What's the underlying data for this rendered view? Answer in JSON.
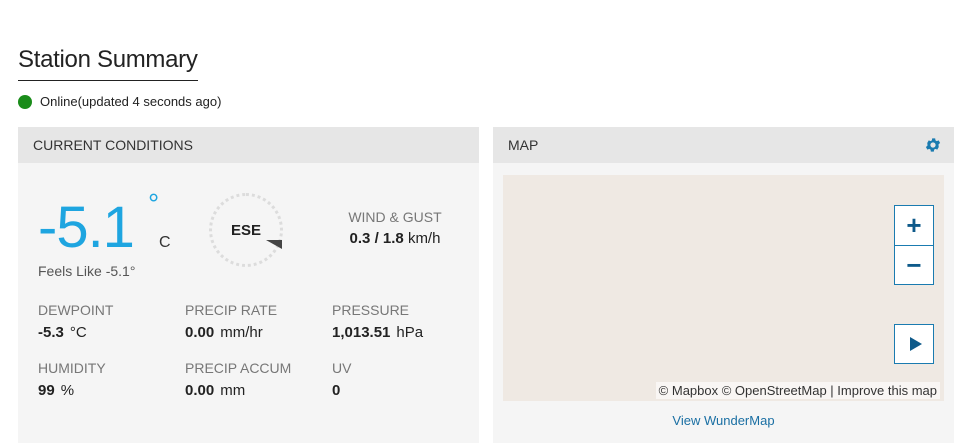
{
  "header": {
    "title": "Station Summary"
  },
  "status": {
    "text": "Online(updated 4 seconds ago)",
    "color": "#1a8c1a"
  },
  "conditions": {
    "title": "CURRENT CONDITIONS",
    "temperature": "-5.1",
    "temp_degree": "°",
    "temp_unit": "C",
    "feels_like": "Feels Like -5.1°",
    "wind_direction": "ESE",
    "wind_label": "WIND & GUST",
    "wind_speed": "0.3",
    "wind_sep": "/",
    "wind_gust": "1.8",
    "wind_unit": "km/h",
    "metrics": [
      {
        "label": "DEWPOINT",
        "value": "-5.3",
        "unit": "°C"
      },
      {
        "label": "PRECIP RATE",
        "value": "0.00",
        "unit": "mm/hr"
      },
      {
        "label": "PRESSURE",
        "value": "1,013.51",
        "unit": "hPa"
      },
      {
        "label": "HUMIDITY",
        "value": "99",
        "unit": "%"
      },
      {
        "label": "PRECIP ACCUM",
        "value": "0.00",
        "unit": "mm"
      },
      {
        "label": "UV",
        "value": "0",
        "unit": ""
      }
    ]
  },
  "map": {
    "title": "MAP",
    "zoom_in": "+",
    "zoom_out": "−",
    "attribution": "© Mapbox © OpenStreetMap | Improve this map",
    "view_link": "View WunderMap",
    "settings_icon": "gear-icon"
  },
  "colors": {
    "temp": "#1ea5e0",
    "accent": "#1a7bb0",
    "link": "#1a6fa3"
  }
}
